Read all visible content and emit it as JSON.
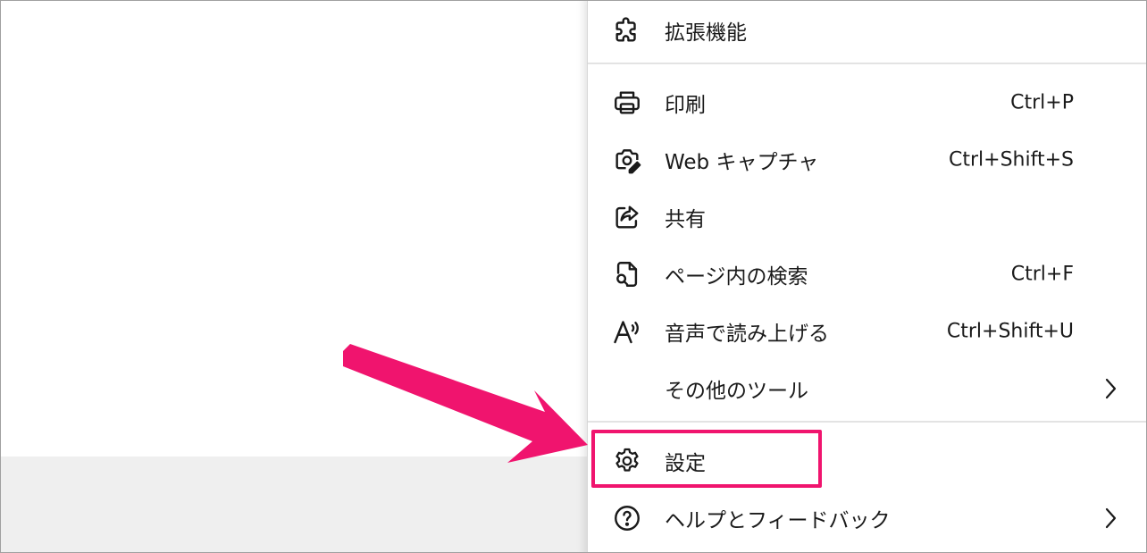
{
  "menu": {
    "items": [
      {
        "label": "拡張機能",
        "shortcut": "",
        "icon": "puzzle-icon"
      },
      {
        "label": "印刷",
        "shortcut": "Ctrl+P",
        "icon": "printer-icon"
      },
      {
        "label": "Web キャプチャ",
        "shortcut": "Ctrl+Shift+S",
        "icon": "camera-icon"
      },
      {
        "label": "共有",
        "shortcut": "",
        "icon": "share-icon"
      },
      {
        "label": "ページ内の検索",
        "shortcut": "Ctrl+F",
        "icon": "find-icon"
      },
      {
        "label": "音声で読み上げる",
        "shortcut": "Ctrl+Shift+U",
        "icon": "read-aloud-icon"
      },
      {
        "label": "その他のツール",
        "shortcut": "",
        "icon": "",
        "submenu": true
      },
      {
        "label": "設定",
        "shortcut": "",
        "icon": "gear-icon"
      },
      {
        "label": "ヘルプとフィードバック",
        "shortcut": "",
        "icon": "help-icon",
        "submenu": true
      }
    ]
  },
  "annotation": {
    "highlight_color": "#f0146e",
    "highlighted_item": "設定"
  }
}
